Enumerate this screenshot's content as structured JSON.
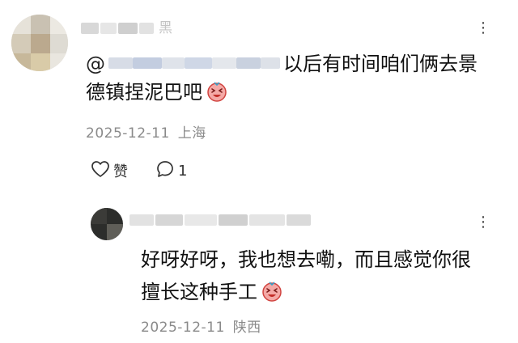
{
  "comment": {
    "username_visible_tail": "黑",
    "mention_prefix": "@",
    "text_line1": "以后有时间咱们俩去景",
    "text_line2": "德镇捏泥巴吧",
    "emoji_icon": "laughing-tears-emoji",
    "date": "2025-12-11",
    "location": "上海",
    "like_label": "赞",
    "reply_count": "1",
    "more_label": "⋮"
  },
  "reply": {
    "text_line1": "好呀好呀，我也想去嘞，而且感觉你很",
    "text_line2": "擅长这种手工",
    "emoji_icon": "laughing-tears-emoji",
    "date": "2025-12-11",
    "location": "陕西",
    "more_label": "⋮"
  },
  "colors": {
    "text": "#111111",
    "meta": "#8a8a8a",
    "background": "#ffffff"
  }
}
